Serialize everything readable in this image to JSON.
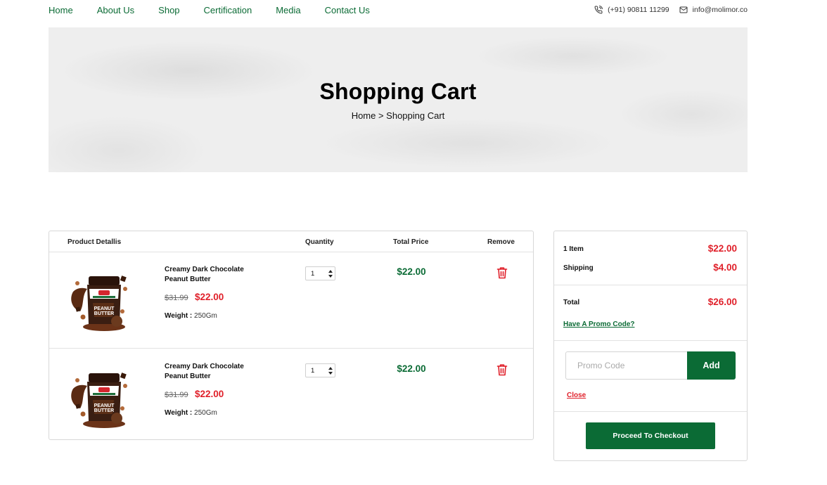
{
  "nav": {
    "links": [
      "Home",
      "About Us",
      "Shop",
      "Certification",
      "Media",
      "Contact Us"
    ],
    "phone": "(+91) 90811 11299",
    "email": "info@molimor.co",
    "phone_icon": "phone-icon",
    "mail_icon": "mail-icon"
  },
  "hero": {
    "title": "Shopping Cart",
    "breadcrumb": "Home > Shopping Cart"
  },
  "cart": {
    "headers": {
      "product": "Product Detallis",
      "quantity": "Quantity",
      "total": "Total Price",
      "remove": "Remove"
    },
    "items": [
      {
        "name": "Creamy Dark Chocolate Peanut Butter",
        "old_price": "$31.99",
        "price": "$22.00",
        "weight_label": "Weight :",
        "weight": "250Gm",
        "quantity": "1",
        "total": "$22.00",
        "remove_icon": "trash-icon"
      },
      {
        "name": "Creamy Dark Chocolate Peanut Butter",
        "old_price": "$31.99",
        "price": "$22.00",
        "weight_label": "Weight :",
        "weight": "250Gm",
        "quantity": "1",
        "total": "$22.00",
        "remove_icon": "trash-icon"
      }
    ]
  },
  "summary": {
    "items_label": "1 Item",
    "items_value": "$22.00",
    "shipping_label": "Shipping",
    "shipping_value": "$4.00",
    "total_label": "Total",
    "total_value": "$26.00",
    "promo_link": "Have A Promo Code?",
    "promo_placeholder": "Promo Code",
    "add_label": "Add",
    "close_label": "Close",
    "checkout_label": "Proceed To Checkout"
  },
  "colors": {
    "brand_green": "#0b6b35",
    "price_red": "#e0202a"
  }
}
